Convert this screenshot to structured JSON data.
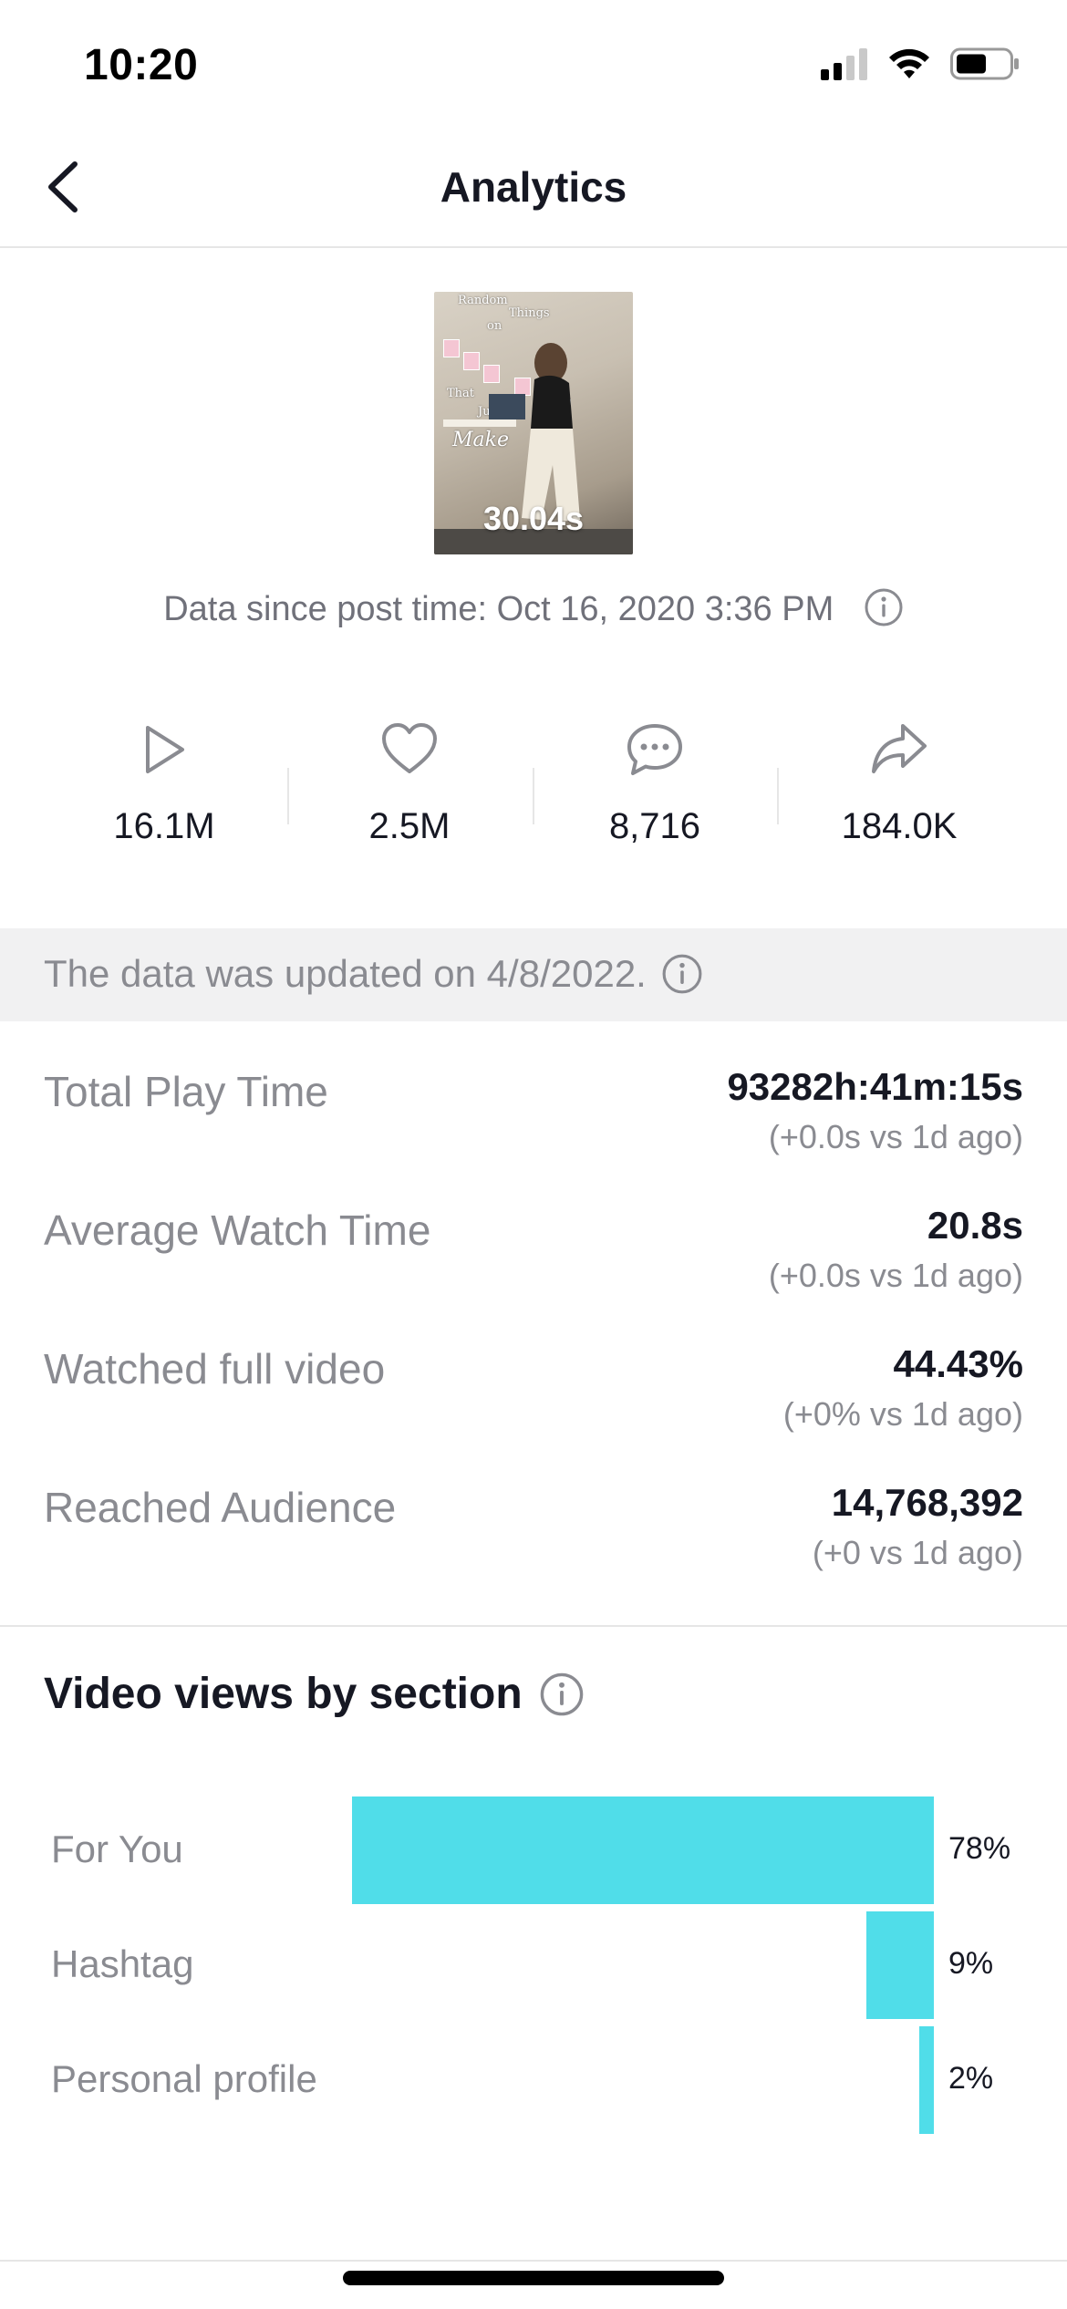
{
  "status_bar": {
    "time": "10:20",
    "icons": [
      "cellular-signal-icon",
      "wifi-icon",
      "battery-icon"
    ]
  },
  "nav": {
    "back_icon": "chevron-left-icon",
    "title": "Analytics"
  },
  "video": {
    "duration": "30.04s",
    "overlay_text": [
      "Random",
      "Things",
      "on",
      "That",
      "Just",
      "Make"
    ],
    "data_since": "Data since post time: Oct 16, 2020 3:36 PM",
    "info_icon": "info-icon"
  },
  "stats": [
    {
      "icon": "play-icon",
      "value": "16.1M"
    },
    {
      "icon": "heart-icon",
      "value": "2.5M"
    },
    {
      "icon": "comment-icon",
      "value": "8,716"
    },
    {
      "icon": "share-icon",
      "value": "184.0K"
    }
  ],
  "banner": {
    "text": "The data was updated on 4/8/2022.",
    "info_icon": "info-icon"
  },
  "metrics": [
    {
      "label": "Total Play Time",
      "value": "93282h:41m:15s",
      "change": "(+0.0s vs 1d ago)"
    },
    {
      "label": "Average Watch Time",
      "value": "20.8s",
      "change": "(+0.0s vs 1d ago)"
    },
    {
      "label": "Watched full video",
      "value": "44.43%",
      "change": "(+0% vs 1d ago)"
    },
    {
      "label": "Reached Audience",
      "value": "14,768,392",
      "change": "(+0 vs 1d ago)"
    }
  ],
  "views_section": {
    "title": "Video views by section",
    "info_icon": "info-icon"
  },
  "colors": {
    "bar": "#50dde9",
    "label_gray": "#8a8b91",
    "text_dark": "#161823",
    "banner_bg": "#f1f1f2"
  },
  "chart_data": {
    "type": "bar",
    "orientation": "horizontal",
    "categories": [
      "For You",
      "Hashtag",
      "Personal profile"
    ],
    "values": [
      78,
      9,
      2
    ],
    "value_labels": [
      "78%",
      "9%",
      "2%"
    ],
    "unit": "%"
  }
}
